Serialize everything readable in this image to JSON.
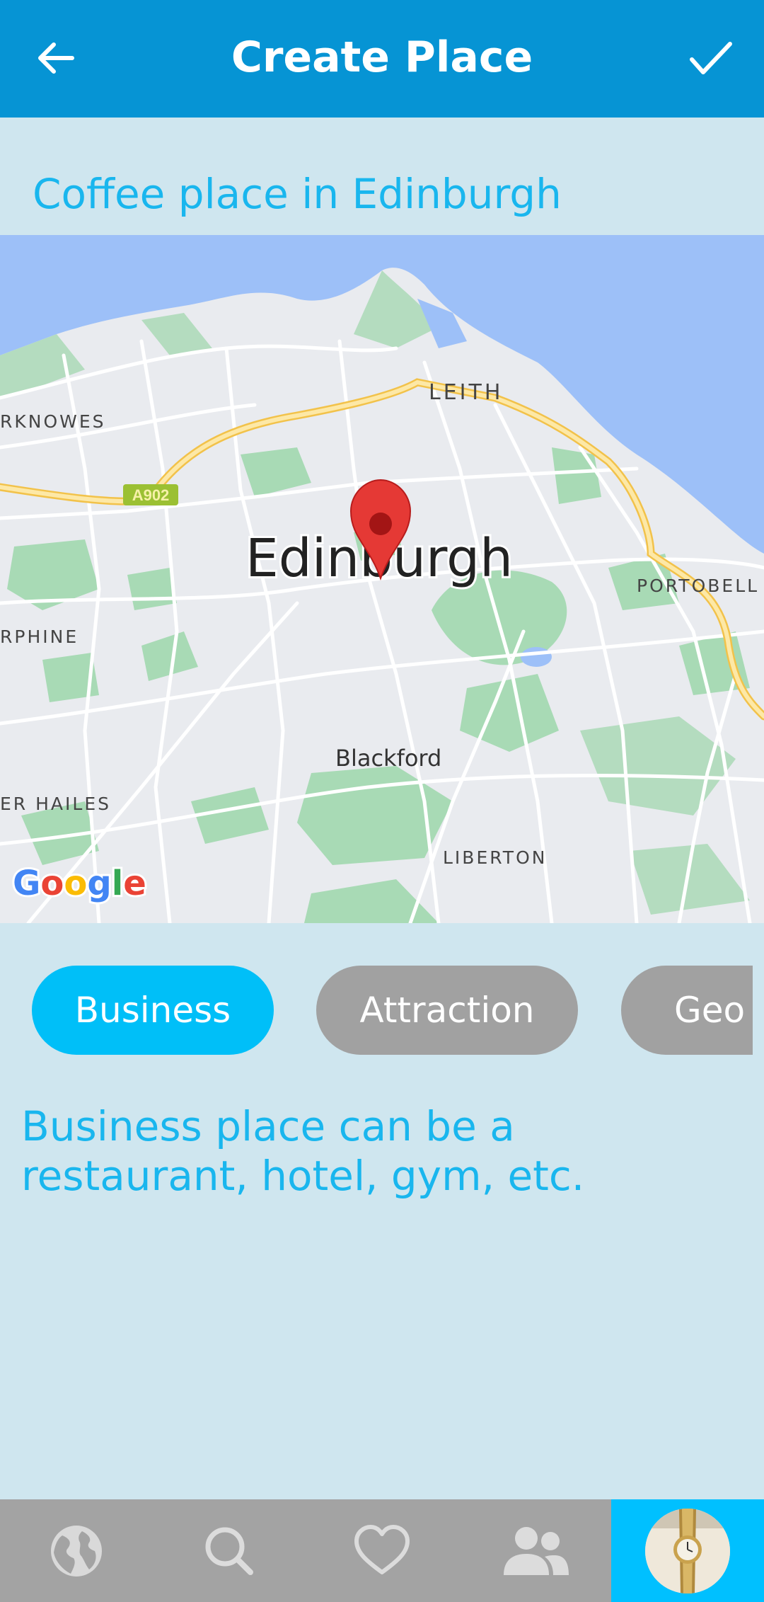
{
  "appbar": {
    "title": "Create Place",
    "back_icon": "arrow-left-icon",
    "confirm_icon": "check-icon"
  },
  "place": {
    "name": "Coffee place in Edinburgh"
  },
  "map": {
    "city_label": "Edinburgh",
    "labels": {
      "leith": "LEITH",
      "craigleith": "RKNOWES",
      "road_a902": "A902",
      "portobello": "PORTOBELL",
      "murrayfield": "RPHINE",
      "blackford": "Blackford",
      "wester_hailes": "ER HAILES",
      "liberton": "LIBERTON"
    },
    "attribution": "Google",
    "marker_icon": "map-pin-icon",
    "colors": {
      "water": "#9dc0f8",
      "land": "#e9ebef",
      "park": "#a8dab5",
      "road_major": "#fbd976"
    }
  },
  "categories": [
    {
      "label": "Business",
      "selected": true
    },
    {
      "label": "Attraction",
      "selected": false
    },
    {
      "label": "Geo C",
      "selected": false
    }
  ],
  "description": "Business place can be a restaurant, hotel, gym, etc.",
  "bottom_nav": [
    {
      "icon": "globe-icon"
    },
    {
      "icon": "search-icon"
    },
    {
      "icon": "heart-icon"
    },
    {
      "icon": "people-icon"
    },
    {
      "icon": "avatar",
      "active": true
    }
  ],
  "colors": {
    "appbar": "#0694d4",
    "background": "#cfe6ef",
    "accent": "#00bff8",
    "text_accent": "#19b6ee",
    "chip_inactive": "#a1a1a1",
    "bottom_bar": "#a3a3a3"
  }
}
